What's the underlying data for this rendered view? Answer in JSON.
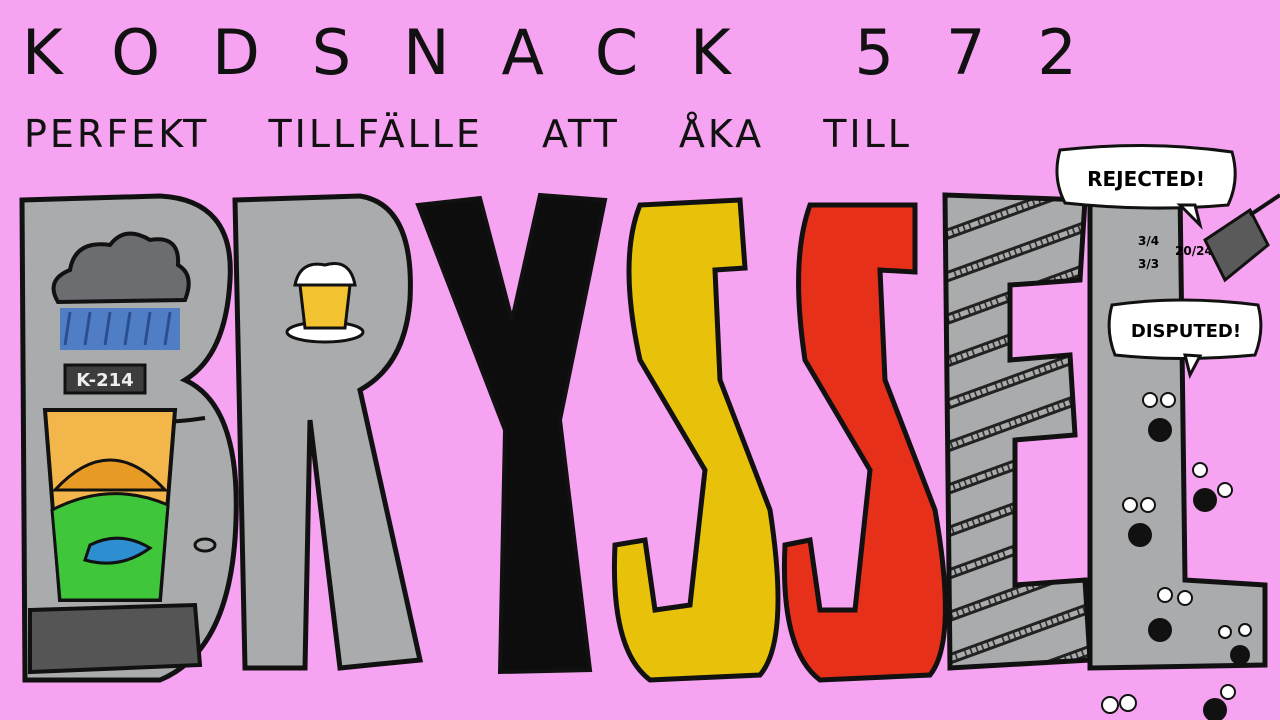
{
  "header": {
    "title": "KODSNACK 572",
    "subtitle": "PERFEKT TILLFÄLLE ATT ÅKA TILL"
  },
  "artwork": {
    "word": "BRYSSEL",
    "door_label": "K-214",
    "bubble_rejected": "REJECTED!",
    "bubble_disputed": "DISPUTED!",
    "calendar_text": [
      "3/4",
      "3/3",
      "20/24"
    ],
    "colors": {
      "background": "#f6a3f1",
      "grey": "#a9abac",
      "black": "#0d0d0d",
      "yellow": "#e8c20a",
      "red": "#e7301a",
      "outline": "#111111"
    },
    "icons": [
      "rain-cloud-icon",
      "beer-glass-icon",
      "sunrise-window-icon",
      "fly-swatter-icon",
      "bug-icon"
    ]
  }
}
